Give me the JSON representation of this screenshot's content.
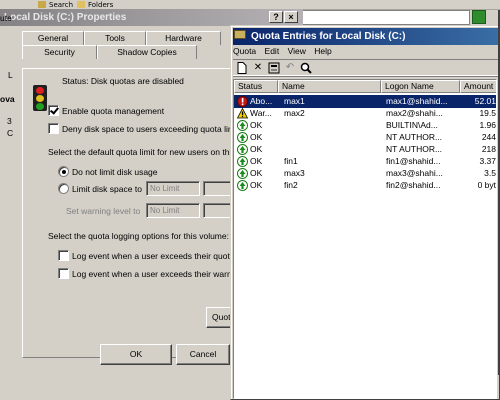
{
  "background": {
    "toolbar_labels": [
      "Search",
      "Folders"
    ],
    "left_edge_fragments": [
      "ute",
      "L",
      "ova",
      "3",
      "C"
    ]
  },
  "properties": {
    "title": "Local Disk (C:) Properties",
    "help_btn": "?",
    "close_btn": "×",
    "tabs": [
      "General",
      "Tools",
      "Hardware",
      "Security",
      "Shadow Copies"
    ],
    "status_text": "Status:  Disk quotas are disabled",
    "enable_quota": "Enable quota management",
    "deny_space": "Deny disk space to users exceeding quota limit",
    "default_limit_label": "Select the default quota limit for new users on this volume:",
    "do_not_limit": "Do not limit disk usage",
    "limit_to": "Limit disk space to",
    "warning_level": "Set warning level to",
    "no_limit_1": "No Limit",
    "no_limit_2": "No Limit",
    "logging_label": "Select the quota logging options for this volume:",
    "log_exceed_quota": "Log event when a user exceeds their quota limit",
    "log_exceed_warn": "Log event when a user exceeds their warning level",
    "quota_entries_btn": "Quota Entries...",
    "ok": "OK",
    "cancel": "Cancel"
  },
  "quota_window": {
    "title": "Quota Entries for Local Disk (C:)",
    "menu": [
      "Quota",
      "Edit",
      "View",
      "Help"
    ],
    "toolbar": [
      "new-icon",
      "delete-icon",
      "properties-icon",
      "undo-icon",
      "find-icon"
    ],
    "columns": [
      "Status",
      "Name",
      "Logon Name",
      "Amount Used"
    ],
    "rows": [
      {
        "status": "Abo...",
        "icon": "error",
        "name": "max1",
        "logon": "max1@shahid...",
        "amount": "52.01",
        "selected": true
      },
      {
        "status": "War...",
        "icon": "warning",
        "name": "max2",
        "logon": "max2@shahi...",
        "amount": "19.5",
        "selected": false
      },
      {
        "status": "OK",
        "icon": "ok",
        "name": "",
        "logon": "BUILTIN\\Ad...",
        "amount": "1.96",
        "selected": false
      },
      {
        "status": "OK",
        "icon": "ok",
        "name": "",
        "logon": "NT AUTHOR...",
        "amount": "244",
        "selected": false
      },
      {
        "status": "OK",
        "icon": "ok",
        "name": "",
        "logon": "NT AUTHOR...",
        "amount": "218",
        "selected": false
      },
      {
        "status": "OK",
        "icon": "ok",
        "name": "fin1",
        "logon": "fin1@shahid...",
        "amount": "3.37",
        "selected": false
      },
      {
        "status": "OK",
        "icon": "ok",
        "name": "max3",
        "logon": "max3@shahi...",
        "amount": "3.5",
        "selected": false
      },
      {
        "status": "OK",
        "icon": "ok",
        "name": "fin2",
        "logon": "fin2@shahid...",
        "amount": "0 byt",
        "selected": false
      }
    ]
  }
}
